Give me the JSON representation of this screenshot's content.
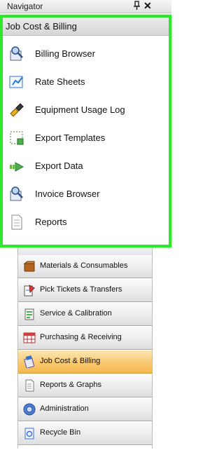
{
  "navigator": {
    "title": "Navigator"
  },
  "flyout": {
    "header": "Job Cost & Billing",
    "items": [
      {
        "label": "Billing Browser",
        "icon": "billing-browser-icon"
      },
      {
        "label": "Rate Sheets",
        "icon": "rate-sheets-icon"
      },
      {
        "label": "Equipment Usage Log",
        "icon": "equipment-usage-icon"
      },
      {
        "label": "Export Templates",
        "icon": "export-templates-icon"
      },
      {
        "label": "Export Data",
        "icon": "export-data-icon"
      },
      {
        "label": "Invoice Browser",
        "icon": "invoice-browser-icon"
      },
      {
        "label": "Reports",
        "icon": "reports-icon"
      }
    ]
  },
  "nav": {
    "items": [
      {
        "label": "Materials & Consumables"
      },
      {
        "label": "Pick Tickets & Transfers"
      },
      {
        "label": "Service & Calibration"
      },
      {
        "label": "Purchasing & Receiving"
      },
      {
        "label": "Job Cost & Billing",
        "active": true
      },
      {
        "label": "Reports & Graphs"
      },
      {
        "label": "Administration"
      },
      {
        "label": "Recycle Bin"
      }
    ]
  },
  "colors": {
    "highlight_border": "#2ee82e",
    "active_tab": "#f8c870"
  }
}
